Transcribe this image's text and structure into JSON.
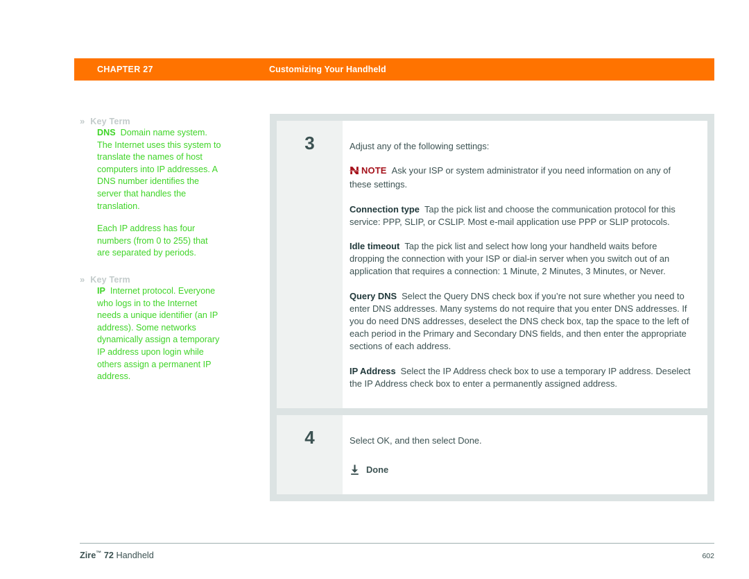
{
  "header": {
    "chapter_label": "CHAPTER 27",
    "title": "Customizing Your Handheld",
    "bar_color": "#FF7300"
  },
  "sidebar": {
    "chevron_glyph": "»",
    "accent_color": "#3FD427",
    "label_color": "#C3CBCB",
    "blocks": [
      {
        "title": "Key Term",
        "term": "DNS",
        "definition": "Domain name system. The Internet uses this system to translate the names of host computers into IP addresses. A DNS number identifies the server that handles the translation.",
        "extra": "Each IP address has four numbers (from 0 to 255) that are separated by periods."
      },
      {
        "title": "Key Term",
        "term": "IP",
        "definition": "Internet protocol. Everyone who logs in to the Internet needs a unique identifier (an IP address). Some networks dynamically assign a temporary IP address upon login while others assign a permanent IP address.",
        "extra": ""
      }
    ]
  },
  "steps": [
    {
      "number": "3",
      "intro": "Adjust any of the following settings:",
      "note": {
        "icon_name": "note-flag-icon",
        "label": "NOTE",
        "color": "#A5121B",
        "text": "Ask your ISP or system administrator if you need information on any of these settings."
      },
      "settings": [
        {
          "name": "Connection type",
          "text": "Tap the pick list and choose the communication protocol for this service: PPP, SLIP, or CSLIP. Most e-mail application use PPP or SLIP protocols."
        },
        {
          "name": "Idle timeout",
          "text": "Tap the pick list and select how long your handheld waits before dropping the connection with your ISP or dial-in server when you switch out of an application that requires a connection: 1 Minute, 2 Minutes, 3 Minutes, or Never."
        },
        {
          "name": "Query DNS",
          "text": "Select the Query DNS check box if you’re not sure whether you need to enter DNS addresses. Many systems do not require that you enter DNS addresses. If you do need DNS addresses, deselect the DNS check box, tap the space to the left of each period in the Primary and Secondary DNS fields, and then enter the appropriate sections of each address."
        },
        {
          "name": "IP Address",
          "text": "Select the IP Address check box to use a temporary IP address. Deselect the IP Address check box to enter a permanently assigned address."
        }
      ]
    },
    {
      "number": "4",
      "intro": "Select OK, and then select Done.",
      "action": {
        "icon_name": "download-done-icon",
        "label": "Done"
      }
    }
  ],
  "footer": {
    "brand": "Zire",
    "trademark": "™",
    "model": "72",
    "kind": "Handheld",
    "page_number": "602"
  }
}
